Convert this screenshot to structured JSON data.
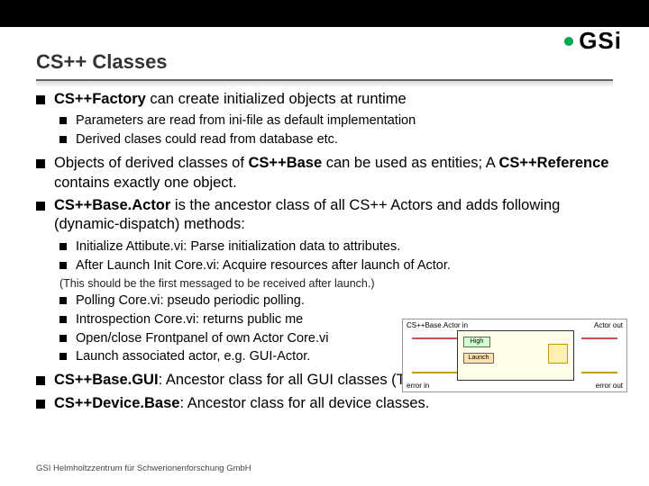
{
  "logo": {
    "text": "GSi"
  },
  "title": "CS++ Classes",
  "bullets": {
    "b1_pre": "",
    "b1_bold": "CS++Factory",
    "b1_post": " can create initialized objects at runtime",
    "b1_sub": [
      "Parameters are read from ini-file as default implementation",
      "Derived clases could read from database etc."
    ],
    "b2_a": "Objects of derived classes of ",
    "b2_b": "CS++Base",
    "b2_c": " can be used as entities; A ",
    "b2_d": "CS++Reference",
    "b2_e": " contains exactly one object.",
    "b3_a": "",
    "b3_b": "CS++Base.Actor",
    "b3_c": " is the ancestor class of all CS++ Actors and adds following (dynamic-dispatch) methods:",
    "b3_sub": [
      "Initialize Attibute.vi: Parse initialization data to attributes.",
      "After Launch Init Core.vi: Acquire resources after launch of Actor."
    ],
    "b3_note": "(This should be the first messaged to be received after launch.)",
    "b3_sub2": [
      "Polling Core.vi: pseudo periodic polling.",
      "Introspection Core.vi: returns public me",
      "Open/close Frontpanel of own Actor Core.vi",
      "Launch associated actor, e.g. GUI-Actor."
    ],
    "b4_a": "",
    "b4_b": "CS++Base.GUI",
    "b4_c": ": Ancestor class for all GUI classes (Template).",
    "b5_a": "",
    "b5_b": "CS++Device.Base",
    "b5_c": ": Ancestor class for all device classes."
  },
  "diagram": {
    "top_left": "CS++Base.Actor in",
    "top_right": "Actor out",
    "bot_left": "error in",
    "bot_right": "error out",
    "priority": "High",
    "act": "Launch"
  },
  "footer": "GSI Helmholtzzentrum für Schwerionenforschung GmbH"
}
